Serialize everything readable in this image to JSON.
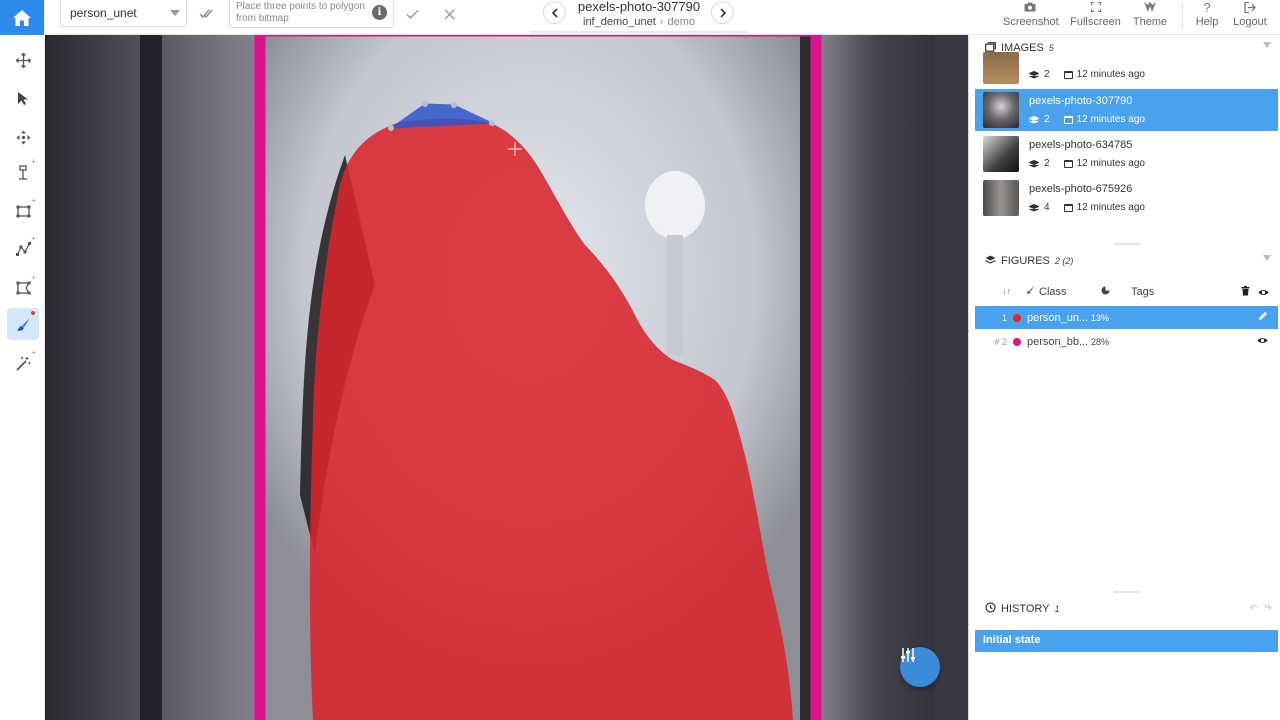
{
  "topbar": {
    "class_select_value": "person_unet",
    "hint_text": "Place three points to polygon from bitmap",
    "image_title": "pexels-photo-307790",
    "dataset_name": "inf_demo_unet",
    "project_name": "demo",
    "actions": [
      {
        "label": "Screenshot",
        "icon": "camera-icon"
      },
      {
        "label": "Fullscreen",
        "icon": "fullscreen-icon"
      },
      {
        "label": "Theme",
        "icon": "theme-icon"
      },
      {
        "label": "Help",
        "icon": "help-icon"
      },
      {
        "label": "Logout",
        "icon": "logout-icon"
      }
    ]
  },
  "toolbar": {
    "tools": [
      "move-tool",
      "select-tool",
      "drag-tool",
      "point-tool",
      "rectangle-tool",
      "polyline-tool",
      "polygon-tool",
      "brush-tool",
      "smart-tool"
    ],
    "active_tool": "brush-tool"
  },
  "images": {
    "title": "IMAGES",
    "count": "5",
    "items": [
      {
        "name": "",
        "layers": "2",
        "time": "12 minutes ago",
        "selected": false
      },
      {
        "name": "pexels-photo-307790",
        "layers": "2",
        "time": "12 minutes ago",
        "selected": true
      },
      {
        "name": "pexels-photo-634785",
        "layers": "2",
        "time": "12 minutes ago",
        "selected": false
      },
      {
        "name": "pexels-photo-675926",
        "layers": "4",
        "time": "12 minutes ago",
        "selected": false
      }
    ]
  },
  "figures": {
    "title": "FIGURES",
    "count": "2 (2)",
    "col_class": "Class",
    "col_tags": "Tags",
    "items": [
      {
        "index": "1",
        "name": "person_un...",
        "percent": "13%",
        "color": "#e2262b",
        "selected": true
      },
      {
        "index": "# 2",
        "name": "person_bb...",
        "percent": "28%",
        "color": "#e0118c",
        "selected": false
      }
    ]
  },
  "history": {
    "title": "HISTORY",
    "count": "1",
    "state": "Initial state"
  },
  "colors": {
    "accent": "#4aa2ee",
    "home": "#2d8ceb",
    "mask_red": "#d8262b",
    "bbox_magenta": "#e0118c",
    "polygon_blue": "#2e56c9"
  }
}
